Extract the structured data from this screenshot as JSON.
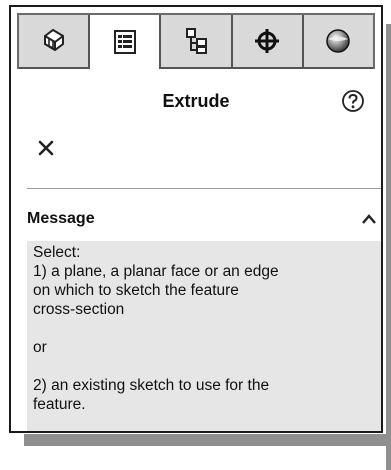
{
  "tabs": [
    {
      "icon": "feature-manager-icon",
      "active": false
    },
    {
      "icon": "property-manager-icon",
      "active": true
    },
    {
      "icon": "configuration-manager-icon",
      "active": false
    },
    {
      "icon": "dimxpert-manager-icon",
      "active": false
    },
    {
      "icon": "display-manager-icon",
      "active": false
    }
  ],
  "panel": {
    "title": "Extrude",
    "help_icon": "help-icon",
    "close_icon": "close-icon"
  },
  "message_section": {
    "title": "Message",
    "collapse_icon": "chevron-up-icon",
    "lines": {
      "select": "Select:",
      "option1_line1": "1) a plane, a planar face or an edge",
      "option1_line2": "on which to sketch the feature",
      "option1_line3": "cross-section",
      "or": "or",
      "option2_line1": "2) an existing sketch to use for the",
      "option2_line2": "feature."
    }
  },
  "colors": {
    "tab_bar": "#d9d9d9",
    "message_background": "#e6e6e6",
    "border": "#1a1a1a"
  }
}
